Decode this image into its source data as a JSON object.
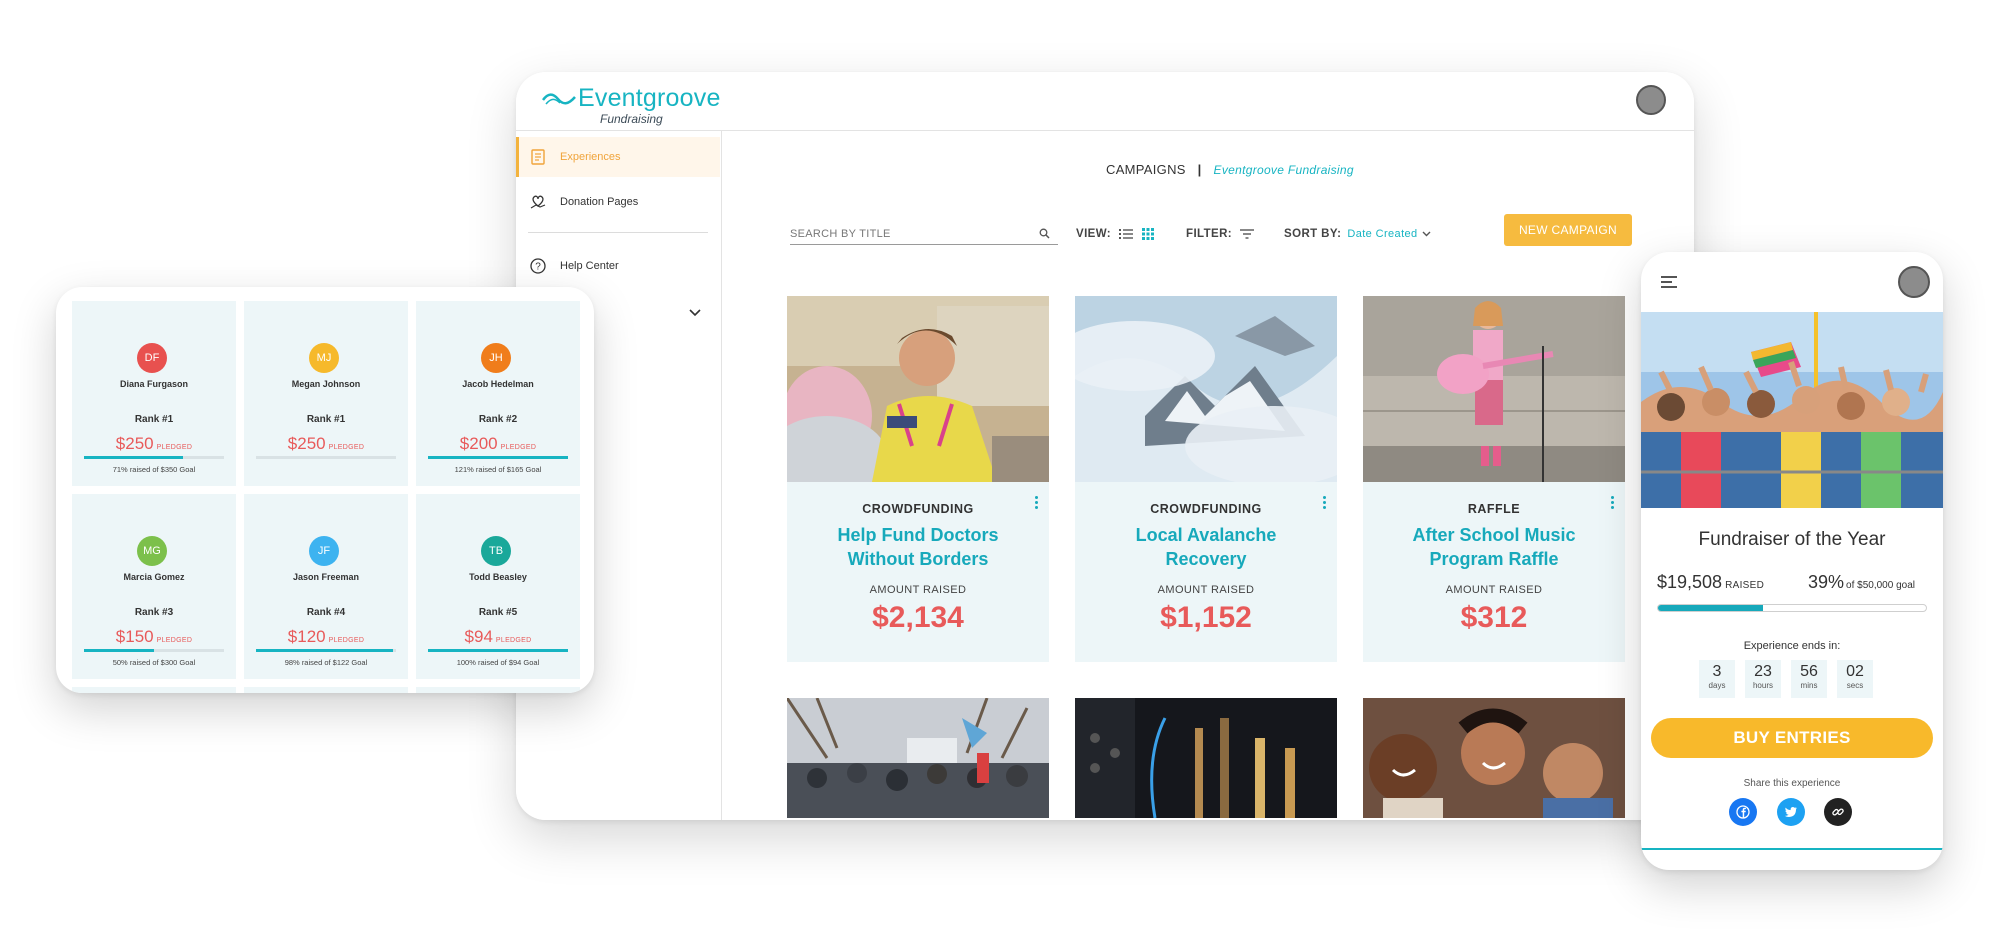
{
  "desktop": {
    "logo": {
      "brand": "Eventgroove",
      "sub": "Fundraising"
    },
    "sidebar": {
      "items": [
        {
          "label": "Experiences",
          "icon": "experiences-icon",
          "active": true
        },
        {
          "label": "Donation Pages",
          "icon": "donation-icon"
        },
        {
          "label": "Help Center",
          "icon": "help-icon"
        }
      ]
    },
    "breadcrumb": {
      "section": "CAMPAIGNS",
      "separator": "|",
      "org": "Eventgroove Fundraising"
    },
    "search": {
      "placeholder": "SEARCH BY TITLE"
    },
    "toolbar": {
      "view_label": "VIEW:",
      "filter_label": "FILTER:",
      "sort_label": "SORT BY:",
      "sort_value": "Date Created",
      "new_button": "NEW CAMPAIGN"
    },
    "campaigns": [
      {
        "type": "CROWDFUNDING",
        "title": "Help Fund Doctors Without Borders",
        "amount_label": "AMOUNT RAISED",
        "amount": "$2,134"
      },
      {
        "type": "CROWDFUNDING",
        "title": "Local Avalanche Recovery",
        "amount_label": "AMOUNT RAISED",
        "amount": "$1,152"
      },
      {
        "type": "RAFFLE",
        "title": "After School Music Program Raffle",
        "amount_label": "AMOUNT RAISED",
        "amount": "$312"
      }
    ]
  },
  "tablet": {
    "fundraisers": [
      {
        "initials": "DF",
        "name": "Diana Furgason",
        "rank": "Rank #1",
        "amount": "$250",
        "pledged": "PLEDGED",
        "goal": "71% raised of $350 Goal",
        "progress": 0.71,
        "color": "#e8514f"
      },
      {
        "initials": "MJ",
        "name": "Megan Johnson",
        "rank": "Rank #1",
        "amount": "$250",
        "pledged": "PLEDGED",
        "goal": "",
        "progress": 0,
        "color": "#f6b92b"
      },
      {
        "initials": "JH",
        "name": "Jacob Hedelman",
        "rank": "Rank #2",
        "amount": "$200",
        "pledged": "PLEDGED",
        "goal": "121% raised of $165 Goal",
        "progress": 1.0,
        "color": "#f07d1b"
      },
      {
        "initials": "MG",
        "name": "Marcia Gomez",
        "rank": "Rank #3",
        "amount": "$150",
        "pledged": "PLEDGED",
        "goal": "50% raised of $300 Goal",
        "progress": 0.5,
        "color": "#7cc04b"
      },
      {
        "initials": "JF",
        "name": "Jason Freeman",
        "rank": "Rank #4",
        "amount": "$120",
        "pledged": "PLEDGED",
        "goal": "98% raised of $122 Goal",
        "progress": 0.98,
        "color": "#3db3f0"
      },
      {
        "initials": "TB",
        "name": "Todd Beasley",
        "rank": "Rank #5",
        "amount": "$94",
        "pledged": "PLEDGED",
        "goal": "100% raised of $94 Goal",
        "progress": 1.0,
        "color": "#1aa89a"
      }
    ]
  },
  "phone": {
    "title": "Fundraiser of the Year",
    "raised": "$19,508",
    "raised_label": "RAISED",
    "percent": "39%",
    "goal_label": "of $50,000 goal",
    "progress": 0.39,
    "ends_label": "Experience ends in:",
    "countdown": [
      {
        "value": "3",
        "unit": "days"
      },
      {
        "value": "23",
        "unit": "hours"
      },
      {
        "value": "56",
        "unit": "mins"
      },
      {
        "value": "02",
        "unit": "secs"
      }
    ],
    "buy_button": "BUY ENTRIES",
    "share_label": "Share this experience",
    "social": [
      "facebook-icon",
      "twitter-icon",
      "link-icon"
    ]
  },
  "colors": {
    "teal": "#17b4c2",
    "amount_red": "#e85a5a",
    "accent_yellow": "#f6bb3f",
    "card_bg": "#edf6f8"
  }
}
